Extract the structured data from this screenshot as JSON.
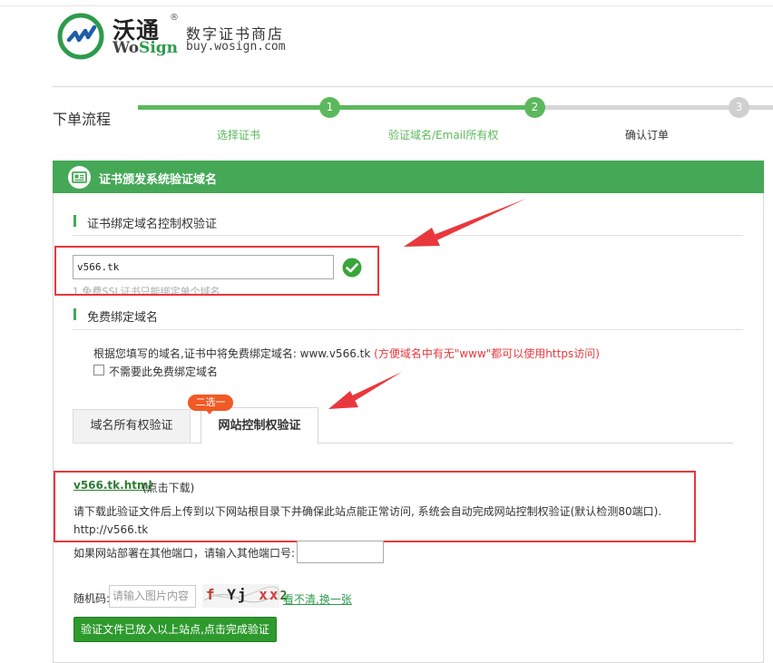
{
  "header": {
    "brand_cn": "沃通",
    "brand_reg": "®",
    "brand_en_wo": "Wo",
    "brand_en_sign": "Sign",
    "store_cn": "数字证书商店",
    "store_url": "buy.wosign.com"
  },
  "process": {
    "title": "下单流程",
    "steps": [
      {
        "num": "1",
        "label": "选择证书"
      },
      {
        "num": "2",
        "label": "验证域名/Email所有权"
      },
      {
        "num": "3",
        "label": "确认订单"
      }
    ],
    "completed_steps": 2
  },
  "panel": {
    "title": "证书颁发系统验证域名",
    "section1": {
      "title": "证书绑定域名控制权验证",
      "domain_value": "v566.tk",
      "hint": "1.免费SSL证书只能绑定单个域名"
    },
    "section2": {
      "title": "免费绑定域名",
      "text_prefix": "根据您填写的域名,证书中将免费绑定域名: www.v566.tk",
      "text_red": "(方便域名中有无\"www\"都可以使用https访问)",
      "checkbox_label": "不需要此免费绑定域名",
      "checkbox_checked": false
    },
    "tabs": [
      {
        "label": "域名所有权验证"
      },
      {
        "label": "网站控制权验证"
      }
    ],
    "active_tab": 1,
    "badge": "二选一",
    "website_verify": {
      "file_link": "v566.tk.html",
      "file_hint": "(点击下载)",
      "desc": "请下载此验证文件后上传到以下网站根目录下并确保此站点能正常访问, 系统会自动完成网站控制权验证(默认检测80端口).",
      "url": "http://v566.tk",
      "port_label": "如果网站部署在其他端口，请输入其他端口号:",
      "port_value": "",
      "captcha_label": "随机码:",
      "captcha_placeholder": "请输入图片内容",
      "captcha_chars": [
        "f",
        "Yj",
        "xx",
        "2"
      ],
      "captcha_refresh": "看不清,换一张",
      "submit_label": "验证文件已放入以上站点,点击完成验证"
    }
  },
  "colors": {
    "green": "#45a857",
    "progress_green": "#5cb85c",
    "annotation_red": "#e8383d",
    "badge_orange": "#f15a24"
  }
}
